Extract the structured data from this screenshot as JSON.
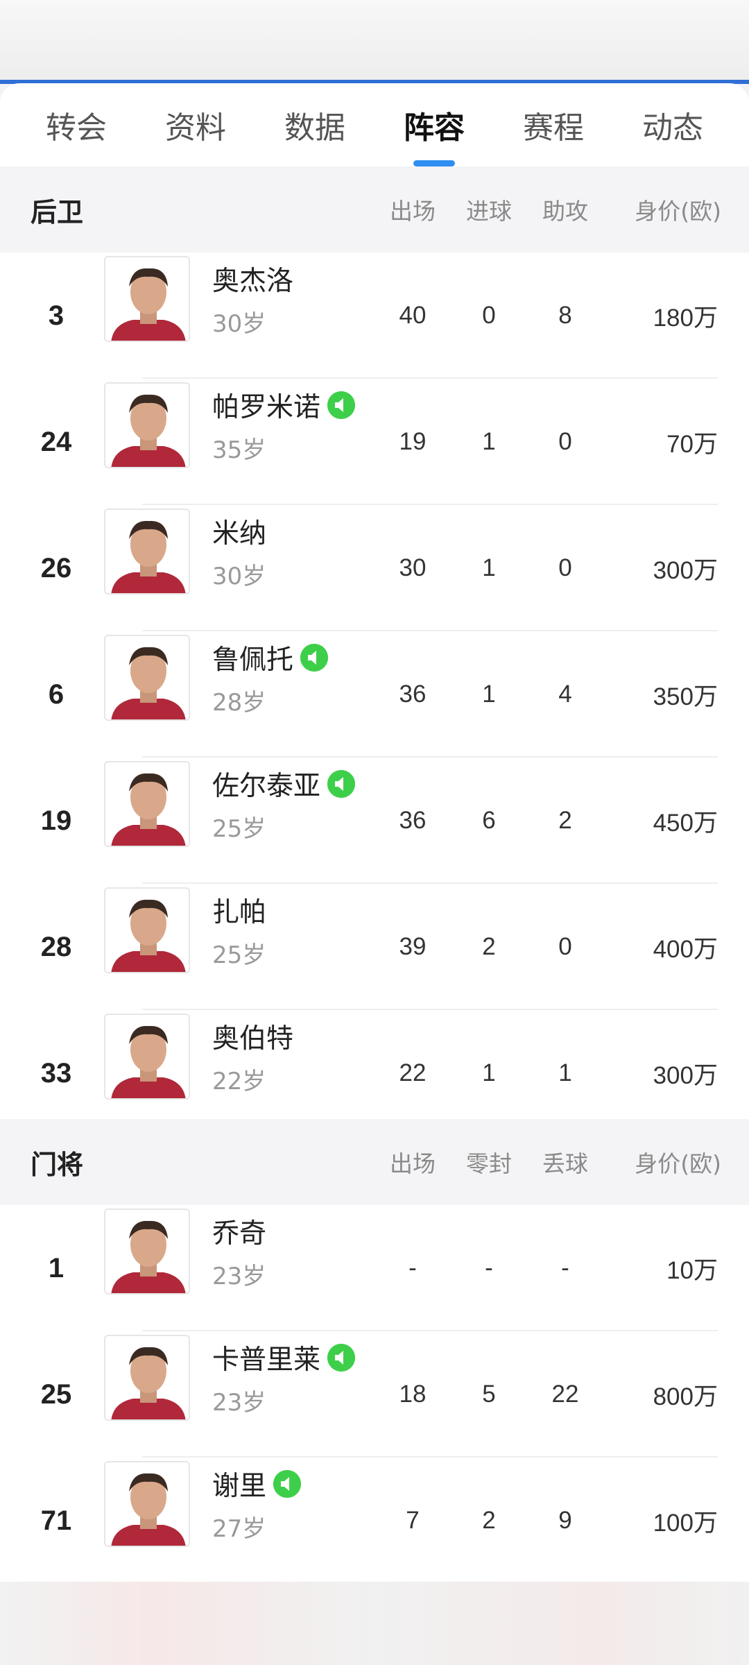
{
  "tabs": [
    {
      "label": "转会"
    },
    {
      "label": "资料"
    },
    {
      "label": "数据"
    },
    {
      "label": "阵容",
      "active": true
    },
    {
      "label": "赛程"
    },
    {
      "label": "动态"
    }
  ],
  "defenders": {
    "title": "后卫",
    "columns": [
      "出场",
      "进球",
      "助攻",
      "身价(欧)"
    ],
    "players": [
      {
        "number": "3",
        "name": "奥杰洛",
        "age": "30岁",
        "vip": false,
        "apps": "40",
        "goals": "0",
        "assists": "8",
        "value": "180万"
      },
      {
        "number": "24",
        "name": "帕罗米诺",
        "age": "35岁",
        "vip": true,
        "apps": "19",
        "goals": "1",
        "assists": "0",
        "value": "70万"
      },
      {
        "number": "26",
        "name": "米纳",
        "age": "30岁",
        "vip": false,
        "apps": "30",
        "goals": "1",
        "assists": "0",
        "value": "300万"
      },
      {
        "number": "6",
        "name": "鲁佩托",
        "age": "28岁",
        "vip": true,
        "apps": "36",
        "goals": "1",
        "assists": "4",
        "value": "350万"
      },
      {
        "number": "19",
        "name": "佐尔泰亚",
        "age": "25岁",
        "vip": true,
        "apps": "36",
        "goals": "6",
        "assists": "2",
        "value": "450万"
      },
      {
        "number": "28",
        "name": "扎帕",
        "age": "25岁",
        "vip": false,
        "apps": "39",
        "goals": "2",
        "assists": "0",
        "value": "400万"
      },
      {
        "number": "33",
        "name": "奥伯特",
        "age": "22岁",
        "vip": false,
        "apps": "22",
        "goals": "1",
        "assists": "1",
        "value": "300万"
      }
    ]
  },
  "goalkeepers": {
    "title": "门将",
    "columns": [
      "出场",
      "零封",
      "丢球",
      "身价(欧)"
    ],
    "players": [
      {
        "number": "1",
        "name": "乔奇",
        "age": "23岁",
        "vip": false,
        "apps": "-",
        "cleansheets": "-",
        "conceded": "-",
        "value": "10万"
      },
      {
        "number": "25",
        "name": "卡普里莱",
        "age": "23岁",
        "vip": true,
        "apps": "18",
        "cleansheets": "5",
        "conceded": "22",
        "value": "800万"
      },
      {
        "number": "71",
        "name": "谢里",
        "age": "27岁",
        "vip": true,
        "apps": "7",
        "cleansheets": "2",
        "conceded": "9",
        "value": "100万"
      }
    ]
  },
  "colors": {
    "accent": "#2f8ff0",
    "vip_badge": "#3ecf4a",
    "jersey": "#b0283a"
  },
  "icons": {
    "vip": "speaker-badge-icon",
    "avatar": "player-avatar-icon"
  }
}
